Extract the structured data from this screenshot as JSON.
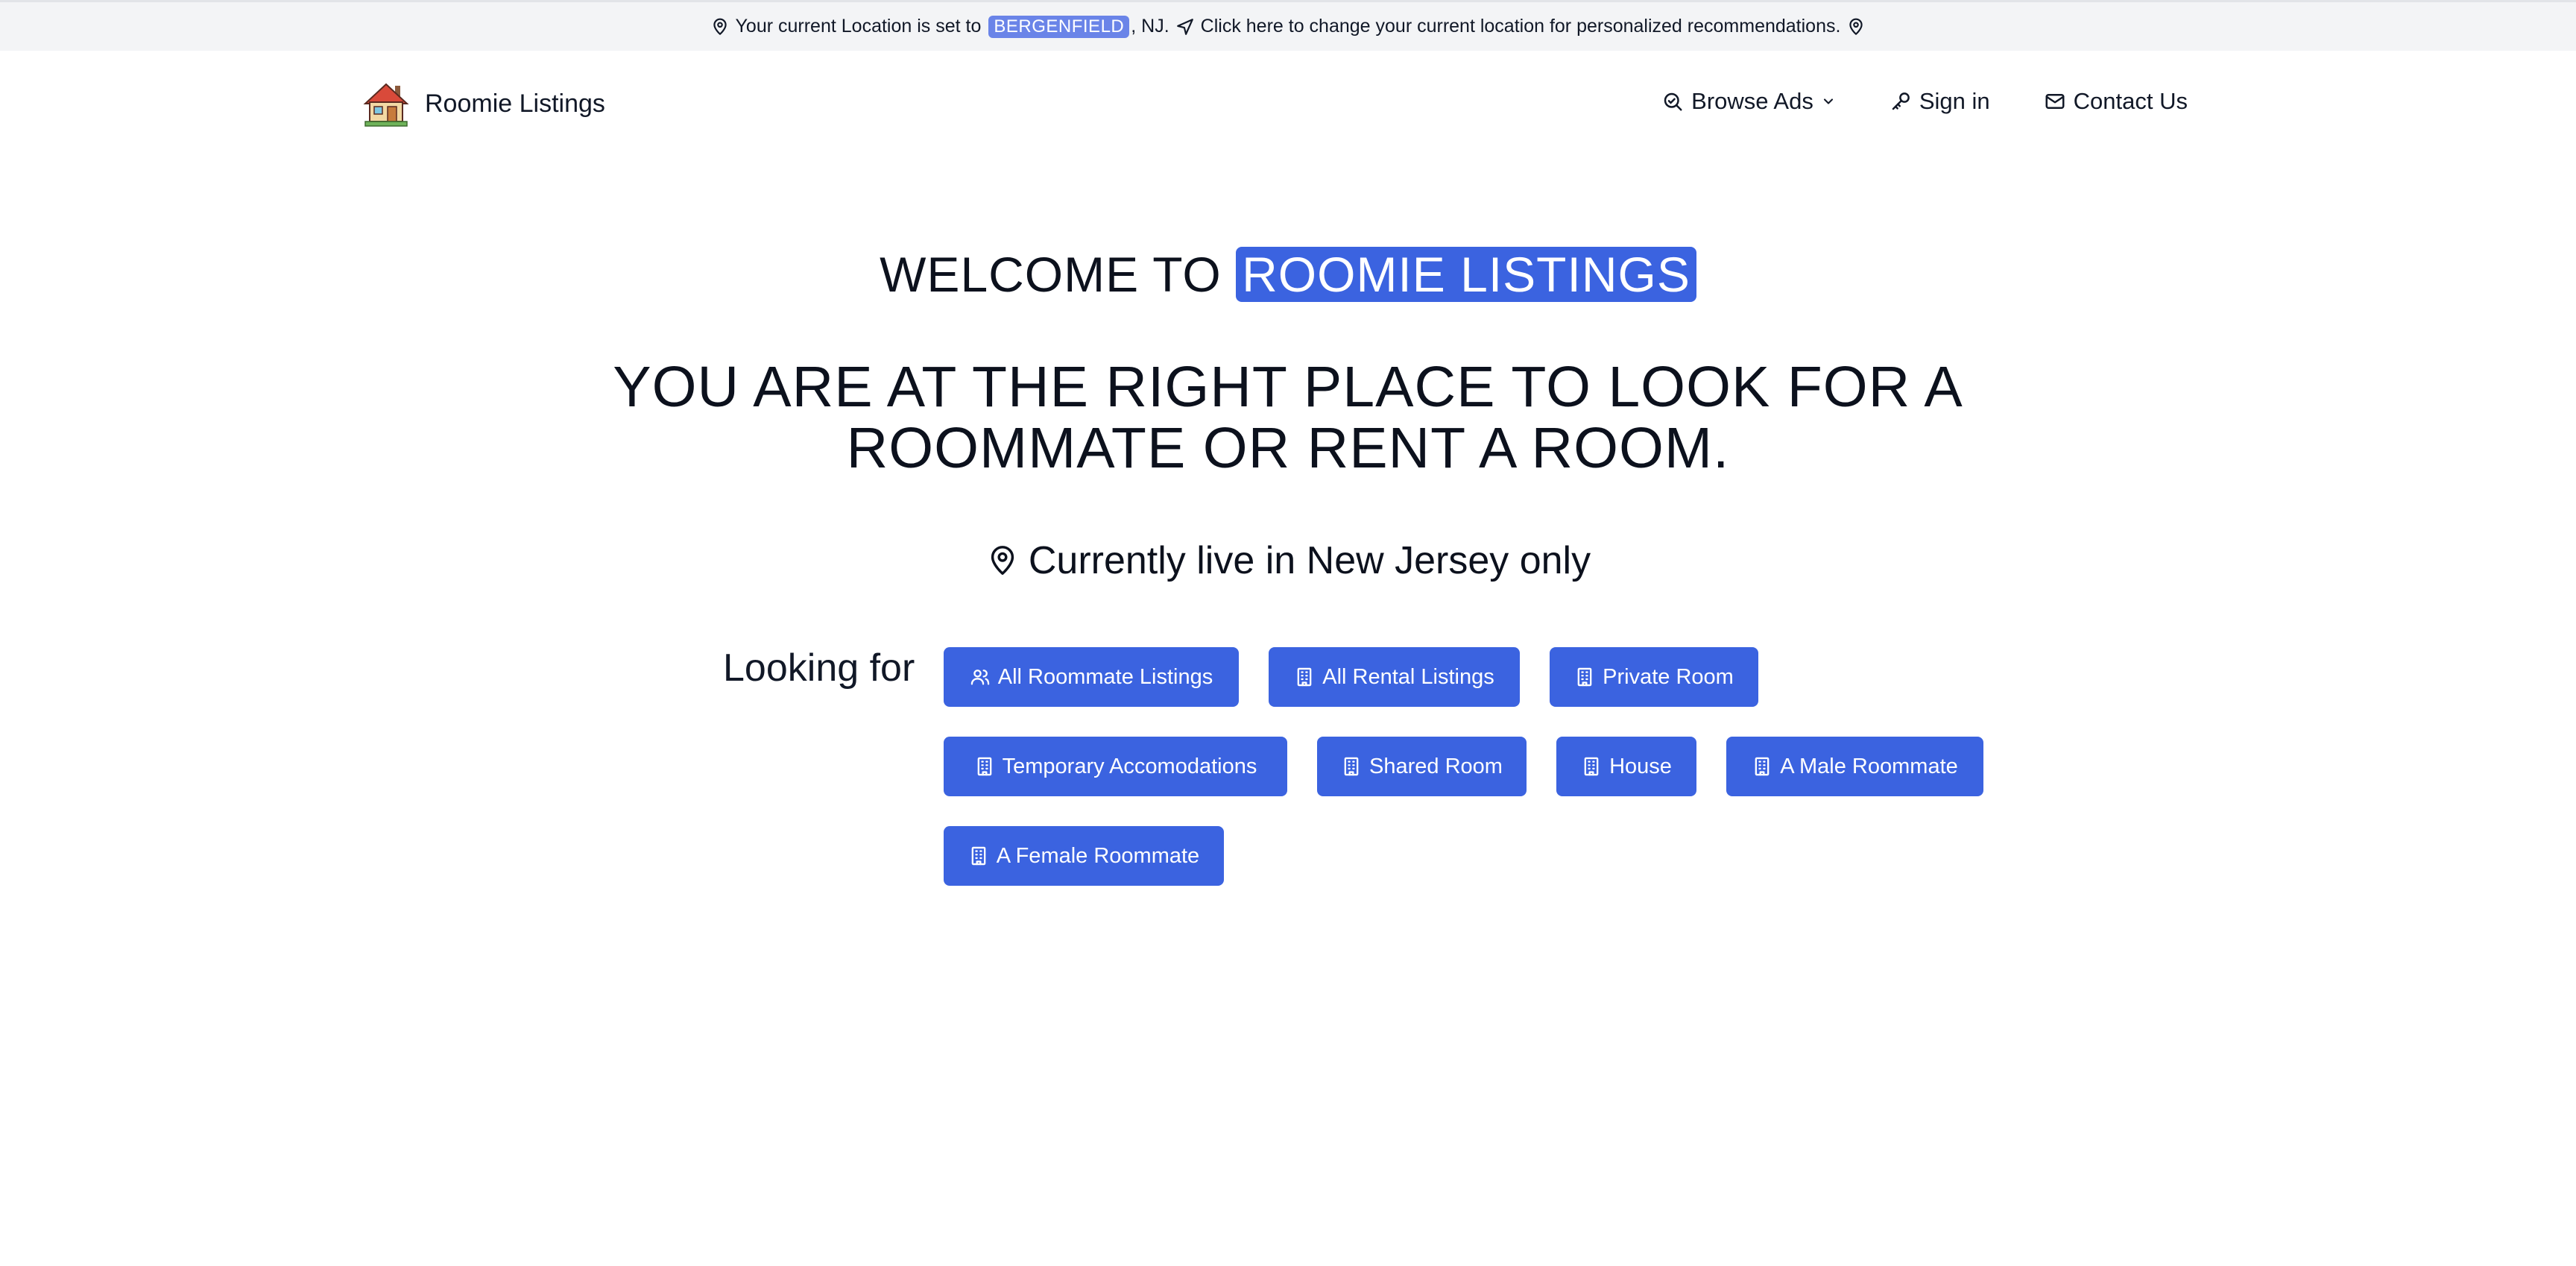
{
  "topbar": {
    "prefix": "Your current Location is set to",
    "location": "BERGENFIELD",
    "state_suffix": ", NJ.",
    "change_link": "Click here to change your current location for personalized recommendations."
  },
  "header": {
    "brand": "Roomie Listings",
    "nav": {
      "browse": "Browse Ads",
      "signin": "Sign in",
      "contact": "Contact Us"
    }
  },
  "hero": {
    "welcome_prefix": "WELCOME TO",
    "welcome_highlight": "ROOMIE LISTINGS",
    "headline_line1": "YOU ARE AT THE RIGHT PLACE TO LOOK FOR A",
    "headline_line2": "ROOMMATE OR RENT A ROOM.",
    "region_note": "Currently live in New Jersey only"
  },
  "looking_for": {
    "label": "Looking for",
    "buttons": [
      {
        "label": "All Roommate Listings",
        "icon": "users-icon"
      },
      {
        "label": "All Rental Listings",
        "icon": "building-icon"
      },
      {
        "label": "Private Room",
        "icon": "building-icon"
      },
      {
        "label": "Temporary Accomodations",
        "icon": "building-icon"
      },
      {
        "label": "Shared Room",
        "icon": "building-icon"
      },
      {
        "label": "House",
        "icon": "building-icon"
      },
      {
        "label": "A Male Roommate",
        "icon": "building-icon"
      },
      {
        "label": "A Female Roommate",
        "icon": "building-icon"
      }
    ]
  },
  "colors": {
    "accent": "#3b63e0",
    "topbar_bg": "#f3f4f6",
    "location_badge": "#6a84e8",
    "text": "#0c111d"
  }
}
